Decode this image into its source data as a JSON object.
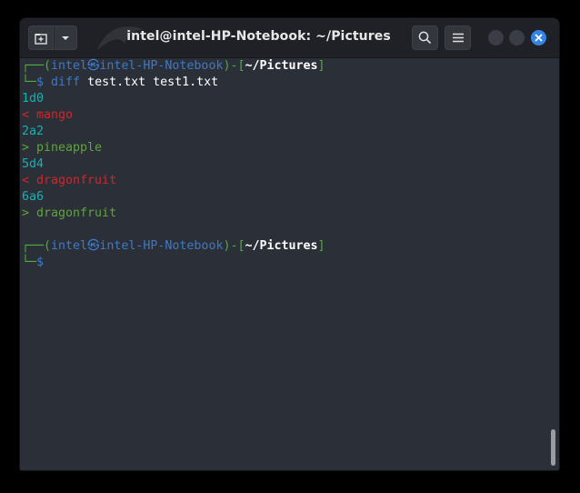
{
  "window": {
    "title": "intel@intel-HP-Notebook: ~/Pictures"
  },
  "titlebar": {
    "new_tab_icon": "new-tab-icon",
    "dropdown_icon": "chevron-down-icon",
    "search_icon": "search-icon",
    "menu_icon": "hamburger-menu-icon",
    "close_icon": "close-icon",
    "close_color": "#3584e4"
  },
  "terminal": {
    "prompt1": {
      "corner_top": "┌──(",
      "user": "intel",
      "at_glyph": "㉿",
      "host": "intel-HP-Notebook",
      "mid": ")-[",
      "path": "~/Pictures",
      "end": "]",
      "corner_bottom": "└─",
      "dollar": "$ ",
      "command": "diff",
      "args": " test.txt test1.txt"
    },
    "output": [
      {
        "text": "1d0",
        "kind": "cyan"
      },
      {
        "text": "< mango",
        "kind": "red"
      },
      {
        "text": "2a2",
        "kind": "cyan"
      },
      {
        "text": "> pineapple",
        "kind": "add"
      },
      {
        "text": "5d4",
        "kind": "cyan"
      },
      {
        "text": "< dragonfruit",
        "kind": "red"
      },
      {
        "text": "6a6",
        "kind": "cyan"
      },
      {
        "text": "> dragonfruit",
        "kind": "add"
      }
    ],
    "prompt2": {
      "corner_top": "┌──(",
      "user": "intel",
      "at_glyph": "㉿",
      "host": "intel-HP-Notebook",
      "mid": ")-[",
      "path": "~/Pictures",
      "end": "]",
      "corner_bottom": "└─",
      "dollar": "$"
    }
  },
  "colors": {
    "prompt_frame": "#4fae3c",
    "prompt_user": "#3d79c9",
    "diff_header": "#13b3b0",
    "diff_removed": "#d0262b",
    "diff_added": "#5fa53a"
  }
}
